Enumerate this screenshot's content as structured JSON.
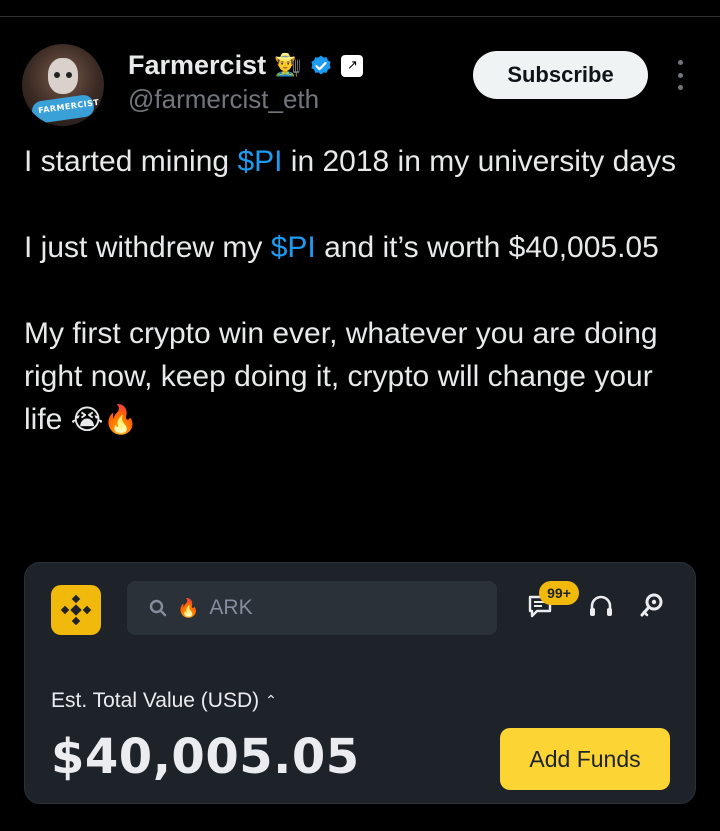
{
  "author": {
    "display_name": "Farmercist",
    "handle": "@farmercist_eth",
    "avatar_band_text": "FARMERCIST",
    "badge_emoji": "👨‍🌾",
    "verified_color": "#1d9bf0"
  },
  "actions": {
    "subscribe_label": "Subscribe"
  },
  "tweet": {
    "line1_pre": "I started mining ",
    "cashtag": "$PI",
    "line1_post": " in 2018 in my university days",
    "line2_pre": "I just withdrew my ",
    "line2_post": " and it’s worth $40,005.05",
    "line3": "My first crypto win ever, whatever you are doing right now, keep doing it, crypto will change your life ",
    "emoji1": "😭",
    "emoji2": "🔥"
  },
  "app_card": {
    "search_fire": "🔥",
    "search_text": "ARK",
    "notif_count": "99+",
    "est_label": "Est. Total Value  (USD)",
    "caret": "⌃",
    "total_value": "$40,005.05",
    "add_funds_label": "Add Funds",
    "brand_color": "#f0b90b"
  }
}
